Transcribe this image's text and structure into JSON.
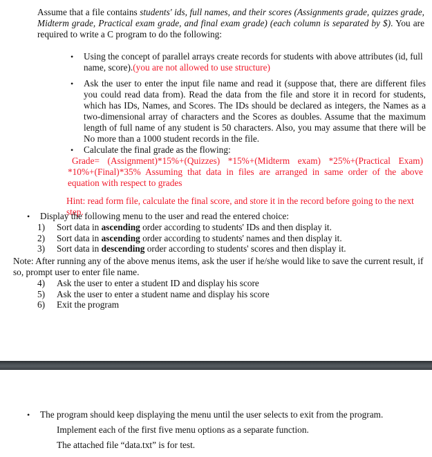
{
  "intro": {
    "plain_1": "Assume that a file contains ",
    "italic_1": "students' ids, full names, and their scores (Assignments grade, quizzes grade, Midterm grade, Practical exam grade, and final exam grade) (each column is separated by $)",
    "plain_2": ". You are required to write a C program to do the following:"
  },
  "bullets": {
    "parallel_arrays": {
      "text": "Using the concept of parallel arrays create records for students with above attributes (id, full name, score).",
      "red": "(you are not allowed to use structure)"
    },
    "read_file": {
      "text": "Ask the user to enter the input file name and read it (suppose that, there are different files you could read data from). Read the data from the file and store it in record for students, which has IDs, Names, and Scores. The IDs should be declared as integers, the Names as a two-dimensional array of characters and the Scores as doubles. Assume that the maximum length of full name of any student is 50 characters.  Also, you may assume that there will be No more than a 1000 student records in the file."
    },
    "calculate": {
      "text": "Calculate the final grade as the flowing:",
      "formula": "Grade=  (Assignment)*15%+(Quizzes)  *15%+(Midterm  exam)  *25%+(Practical  Exam) *10%+(Final)*35% Assuming that data in files are arranged in same order of the above equation with respect to grades"
    },
    "hint": "Hint: read form file, calculate the final score, and store it in the record before going to the next step.",
    "menu_intro": "Display the following menu to the user and read the entered choice:"
  },
  "menu": [
    {
      "num": "1)",
      "pre": "Sort data in ",
      "bold": "ascending",
      "post": " order according to students' IDs and then display it."
    },
    {
      "num": "2)",
      "pre": "Sort data in ",
      "bold": "ascending",
      "post": " order according to students' names and then display it."
    },
    {
      "num": "3)",
      "pre": "Sort data in ",
      "bold": "descending",
      "post": " order according to students' scores and then display it."
    },
    {
      "num": "4)",
      "text": "Ask the user to enter a student ID and display his score"
    },
    {
      "num": "5)",
      "text": "Ask the user to enter a student name and display his score"
    },
    {
      "num": "6)",
      "text": "Exit the program"
    }
  ],
  "note": "Note: After running any of the above menus items, ask the user if he/she would like to save the current result, if so, prompt user to enter file name.",
  "footer": {
    "bullet": "The program should keep displaying the menu until the user selects to exit from the program.",
    "line2": "Implement each of the first five menu options as a separate function.",
    "line3": "The attached file “data.txt” is for test."
  },
  "glyphs": {
    "bullet": "•"
  },
  "colors": {
    "red": "#f0192a",
    "separator": "#4a4f54"
  }
}
